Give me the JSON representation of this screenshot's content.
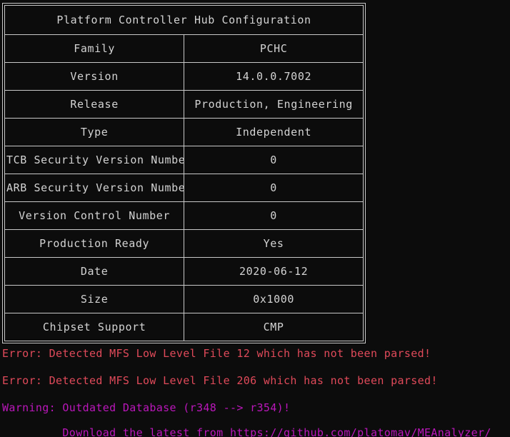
{
  "terminal": {
    "background_color": "#0c0c0c",
    "text_color": "#d3d3d3",
    "error_color": "#e04a5a",
    "warning_color": "#bb17bb"
  },
  "table": {
    "title": "Platform Controller Hub Configuration",
    "rows": [
      {
        "key": "Family",
        "value": "PCHC"
      },
      {
        "key": "Version",
        "value": "14.0.0.7002"
      },
      {
        "key": "Release",
        "value": "Production, Engineering"
      },
      {
        "key": "Type",
        "value": "Independent"
      },
      {
        "key": "TCB Security Version Number",
        "value": "0"
      },
      {
        "key": "ARB Security Version Number",
        "value": "0"
      },
      {
        "key": "Version Control Number",
        "value": "0"
      },
      {
        "key": "Production Ready",
        "value": "Yes"
      },
      {
        "key": "Date",
        "value": "2020-06-12"
      },
      {
        "key": "Size",
        "value": "0x1000"
      },
      {
        "key": "Chipset Support",
        "value": "CMP"
      }
    ]
  },
  "messages": {
    "error_1": "Error: Detected MFS Low Level File 12 which has not been parsed!",
    "error_2": "Error: Detected MFS Low Level File 206 which has not been parsed!",
    "warning_1": "Warning: Outdated Database (r348 --> r354)!",
    "warning_2": "         Download the latest from https://github.com/platomav/MEAnalyzer/"
  }
}
